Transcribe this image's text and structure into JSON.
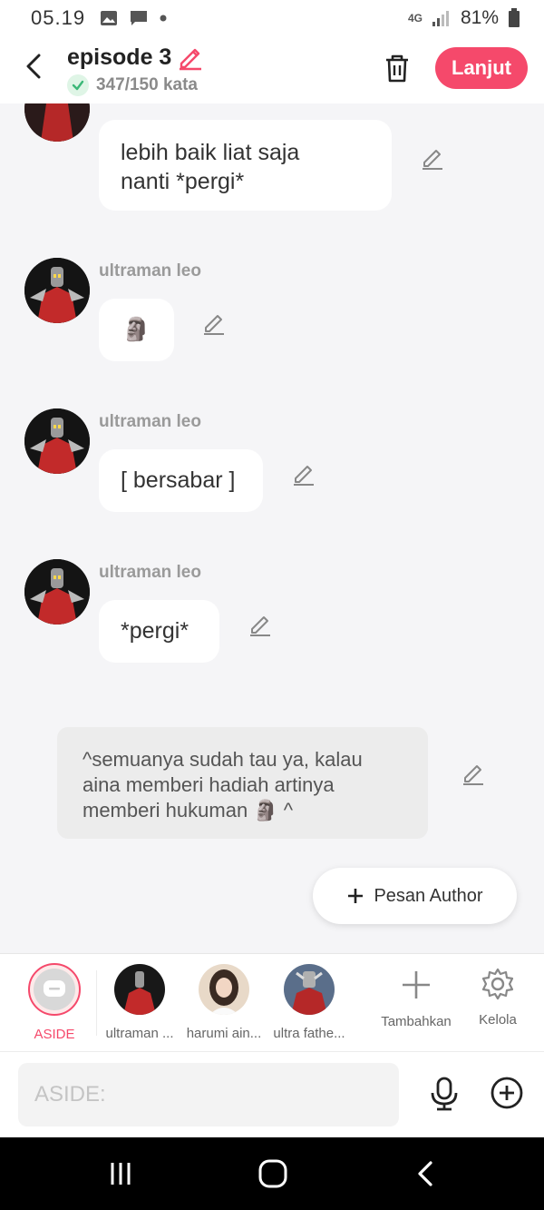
{
  "status_bar": {
    "time": "05.19",
    "network": "4G",
    "battery": "81%"
  },
  "header": {
    "title": "episode 3",
    "word_count": "347/150 kata",
    "next_label": "Lanjut"
  },
  "messages": [
    {
      "type": "dialog",
      "sender": "",
      "text_lines": [
        "lebih baik liat saja",
        "nanti *pergi*"
      ]
    },
    {
      "type": "dialog",
      "sender": "ultraman leo",
      "text": "🗿"
    },
    {
      "type": "dialog",
      "sender": "ultraman leo",
      "text": "[ bersabar ]"
    },
    {
      "type": "dialog",
      "sender": "ultraman leo",
      "text": "*pergi*"
    },
    {
      "type": "aside",
      "text_lines": [
        "^semuanya sudah tau ya, kalau",
        "aina memberi hadiah artinya",
        "memberi hukuman 🗿 ^"
      ]
    }
  ],
  "author_button": {
    "label": "Pesan Author"
  },
  "characters": [
    {
      "label": "ASIDE",
      "active": true
    },
    {
      "label": "ultraman ..."
    },
    {
      "label": "harumi ain..."
    },
    {
      "label": "ultra fathe..."
    }
  ],
  "actions": {
    "add_label": "Tambahkan",
    "manage_label": "Kelola"
  },
  "input": {
    "placeholder": "ASIDE:"
  },
  "colors": {
    "accent": "#f5496b",
    "background": "#f5f5f7",
    "bubble": "#ffffff",
    "aside_bubble": "#ececec"
  },
  "icons": [
    "back-icon",
    "pencil-icon",
    "check-icon",
    "trash-icon",
    "plus-icon",
    "gear-icon",
    "mic-icon",
    "plus-circle-icon",
    "recents-icon",
    "home-icon",
    "nav-back-icon"
  ]
}
